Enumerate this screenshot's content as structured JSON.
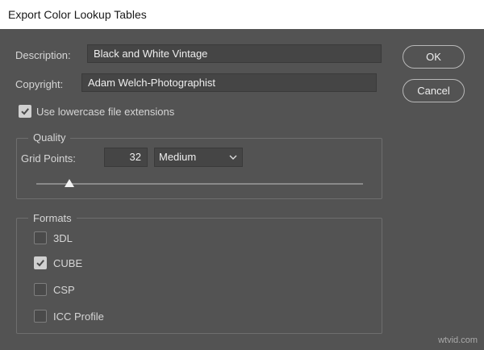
{
  "window": {
    "title": "Export Color Lookup Tables"
  },
  "description": {
    "label": "Description:",
    "value": "Black and White Vintage"
  },
  "copyright": {
    "label": "Copyright:",
    "value": "Adam Welch-Photographist"
  },
  "lowercase": {
    "label": "Use lowercase file extensions",
    "checked": true
  },
  "buttons": {
    "ok": "OK",
    "cancel": "Cancel"
  },
  "quality": {
    "title": "Quality",
    "grid_points_label": "Grid Points:",
    "grid_points_value": "32",
    "preset": "Medium",
    "slider_level": 0.1
  },
  "formats": {
    "title": "Formats",
    "items": [
      {
        "label": "3DL",
        "checked": false
      },
      {
        "label": "CUBE",
        "checked": true
      },
      {
        "label": "CSP",
        "checked": false
      },
      {
        "label": "ICC Profile",
        "checked": false
      }
    ]
  },
  "watermark": "wtvid.com"
}
